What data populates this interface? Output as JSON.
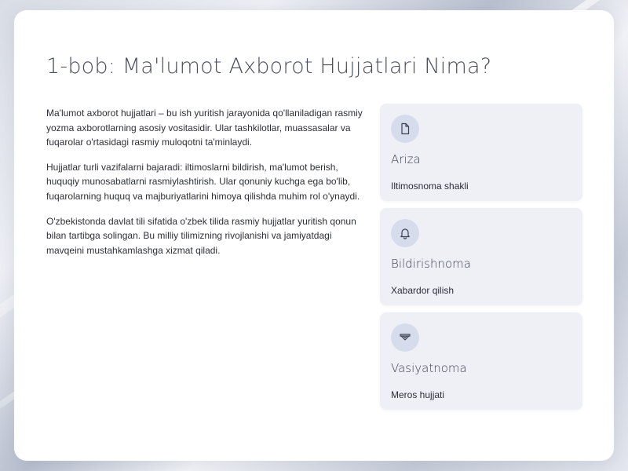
{
  "page": {
    "title": "1-bob: Ma'lumot Axborot Hujjatlari Nima?"
  },
  "intro": {
    "paragraphs": [
      "Ma'lumot axborot hujjatlari – bu ish yuritish jarayonida qo'llaniladigan rasmiy yozma axborotlarning asosiy vositasidir. Ular tashkilotlar, muassasalar va fuqarolar o'rtasidagi rasmiy muloqotni ta'minlaydi.",
      "Hujjatlar turli vazifalarni bajaradi: iltimoslarni bildirish, ma'lumot berish, huquqiy munosabatlarni rasmiylashtirish. Ular qonuniy kuchga ega bo'lib, fuqarolarning huquq va majburiyatlarini himoya qilishda muhim rol o'ynaydi.",
      "O'zbekistonda davlat tili sifatida o'zbek tilida rasmiy hujjatlar yuritish qonun bilan tartibga solingan. Bu milliy tilimizning rivojlanishi va jamiyatdagi mavqeini mustahkamlashga xizmat qiladi."
    ]
  },
  "features": [
    {
      "icon": "document-icon",
      "title": "Ariza",
      "description": "Iltimosnoma shakli"
    },
    {
      "icon": "bell-icon",
      "title": "Bildirishnoma",
      "description": "Xabardor qilish"
    },
    {
      "icon": "scroll-icon",
      "title": "Vasiyatnoma",
      "description": "Meros hujjati"
    }
  ],
  "colors": {
    "card_background": "#ffffff",
    "feature_background": "#eef0f6",
    "icon_circle": "#d7dcec",
    "title_text": "#4a4f5c",
    "body_text": "#2c2f36"
  }
}
